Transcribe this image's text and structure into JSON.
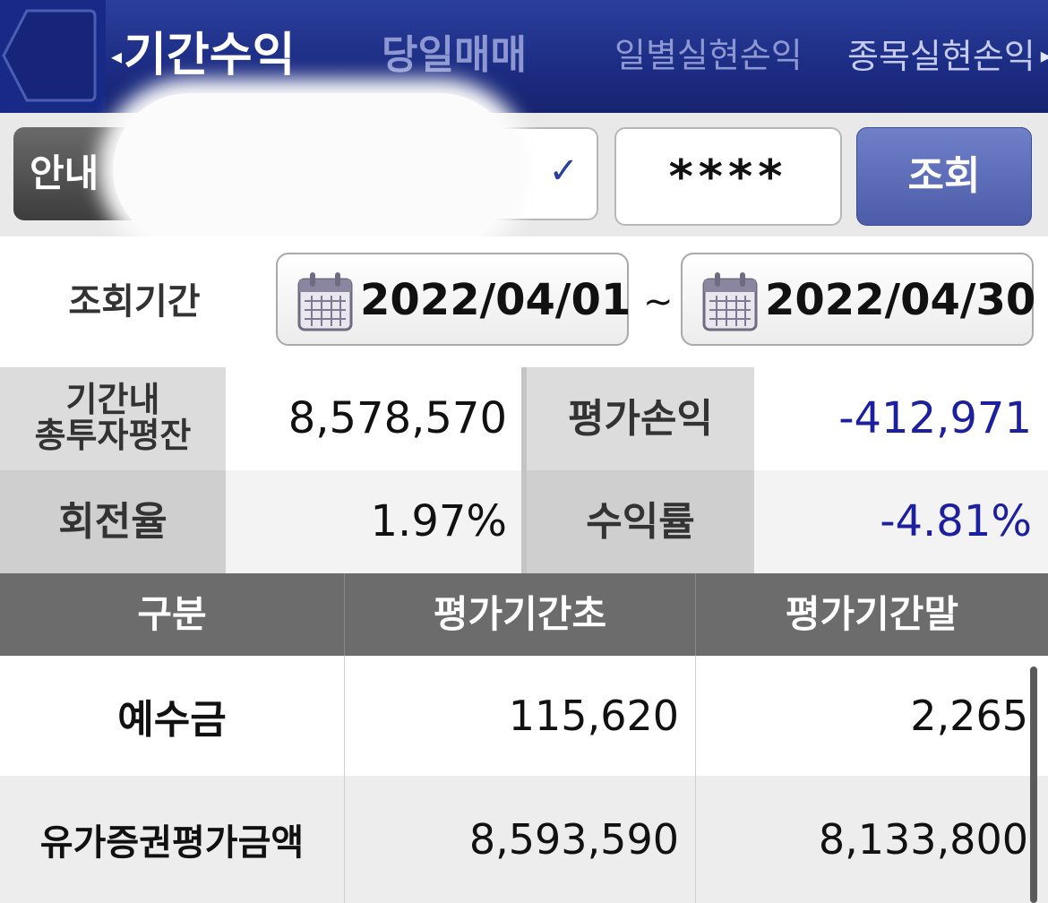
{
  "topbar": {
    "tabs": [
      {
        "label": "기간수익",
        "active": true
      },
      {
        "label": "당일매매"
      },
      {
        "label": "일별실현손익"
      },
      {
        "label": "종목실현손익"
      }
    ],
    "prev_arrow": "◂",
    "next_arrow": "▸"
  },
  "account": {
    "info_label": "안내",
    "selected_account": "",
    "password_mask": "****",
    "query_label": "조회"
  },
  "period": {
    "label": "조회기간",
    "start": "2022/04/01",
    "separator": "~",
    "end": "2022/04/30"
  },
  "summary": {
    "avg_invest_label_line1": "기간내",
    "avg_invest_label_line2": "총투자평잔",
    "avg_invest_value": "8,578,570",
    "eval_pl_label": "평가손익",
    "eval_pl_value": "-412,971",
    "turnover_label": "회전율",
    "turnover_value": "1.97%",
    "return_label": "수익률",
    "return_value": "-4.81%"
  },
  "table": {
    "headers": [
      "구분",
      "평가기간초",
      "평가기간말"
    ],
    "rows": [
      {
        "name": "예수금",
        "start": "115,620",
        "end": "2,265"
      },
      {
        "name": "유가증권평가금액",
        "start": "8,593,590",
        "end": "8,133,800"
      }
    ]
  },
  "colors": {
    "header_blue": "#1c2c83",
    "negative_blue": "#1c1f9e",
    "table_header_gray": "#6c6c6c"
  },
  "icons": [
    "back-arrow-icon",
    "chevron-down-icon",
    "calendar-icon"
  ]
}
